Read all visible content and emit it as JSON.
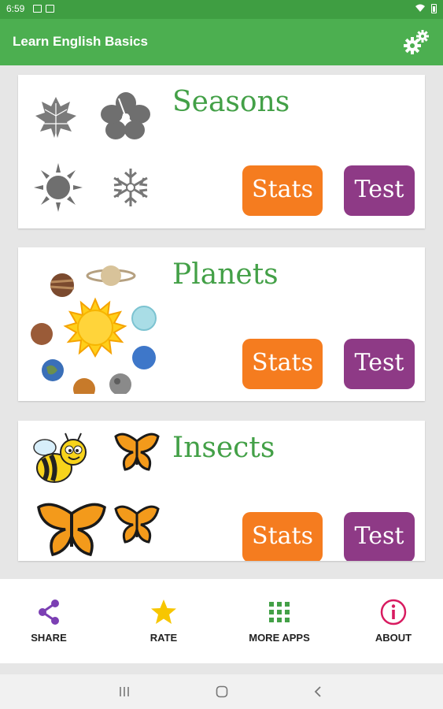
{
  "status_bar": {
    "time": "6:59"
  },
  "app_bar": {
    "title": "Learn English Basics",
    "settings_icon": "gears-icon"
  },
  "colors": {
    "primary": "#4caf50",
    "status": "#3f9e42",
    "title_green": "#43a047",
    "stats_orange": "#f57c1f",
    "test_purple": "#8e3a86"
  },
  "cards": [
    {
      "title": "Seasons",
      "stats_label": "Stats",
      "test_label": "Test",
      "images": [
        "maple-leaf-icon",
        "hibiscus-flower-icon",
        "sun-icon",
        "snowflake-icon"
      ]
    },
    {
      "title": "Planets",
      "stats_label": "Stats",
      "test_label": "Test",
      "images": [
        "solar-system-icon"
      ]
    },
    {
      "title": "Insects",
      "stats_label": "Stats",
      "test_label": "Test",
      "images": [
        "bee-icon",
        "butterfly-icon",
        "butterfly-icon",
        "butterfly-icon"
      ]
    }
  ],
  "bottom_nav": [
    {
      "label": "SHARE",
      "icon": "share-icon",
      "color": "#7b3fb3"
    },
    {
      "label": "RATE",
      "icon": "star-icon",
      "color": "#f7c600"
    },
    {
      "label": "MORE APPS",
      "icon": "grid-icon",
      "color": "#43a047"
    },
    {
      "label": "ABOUT",
      "icon": "info-icon",
      "color": "#d81b60"
    }
  ]
}
